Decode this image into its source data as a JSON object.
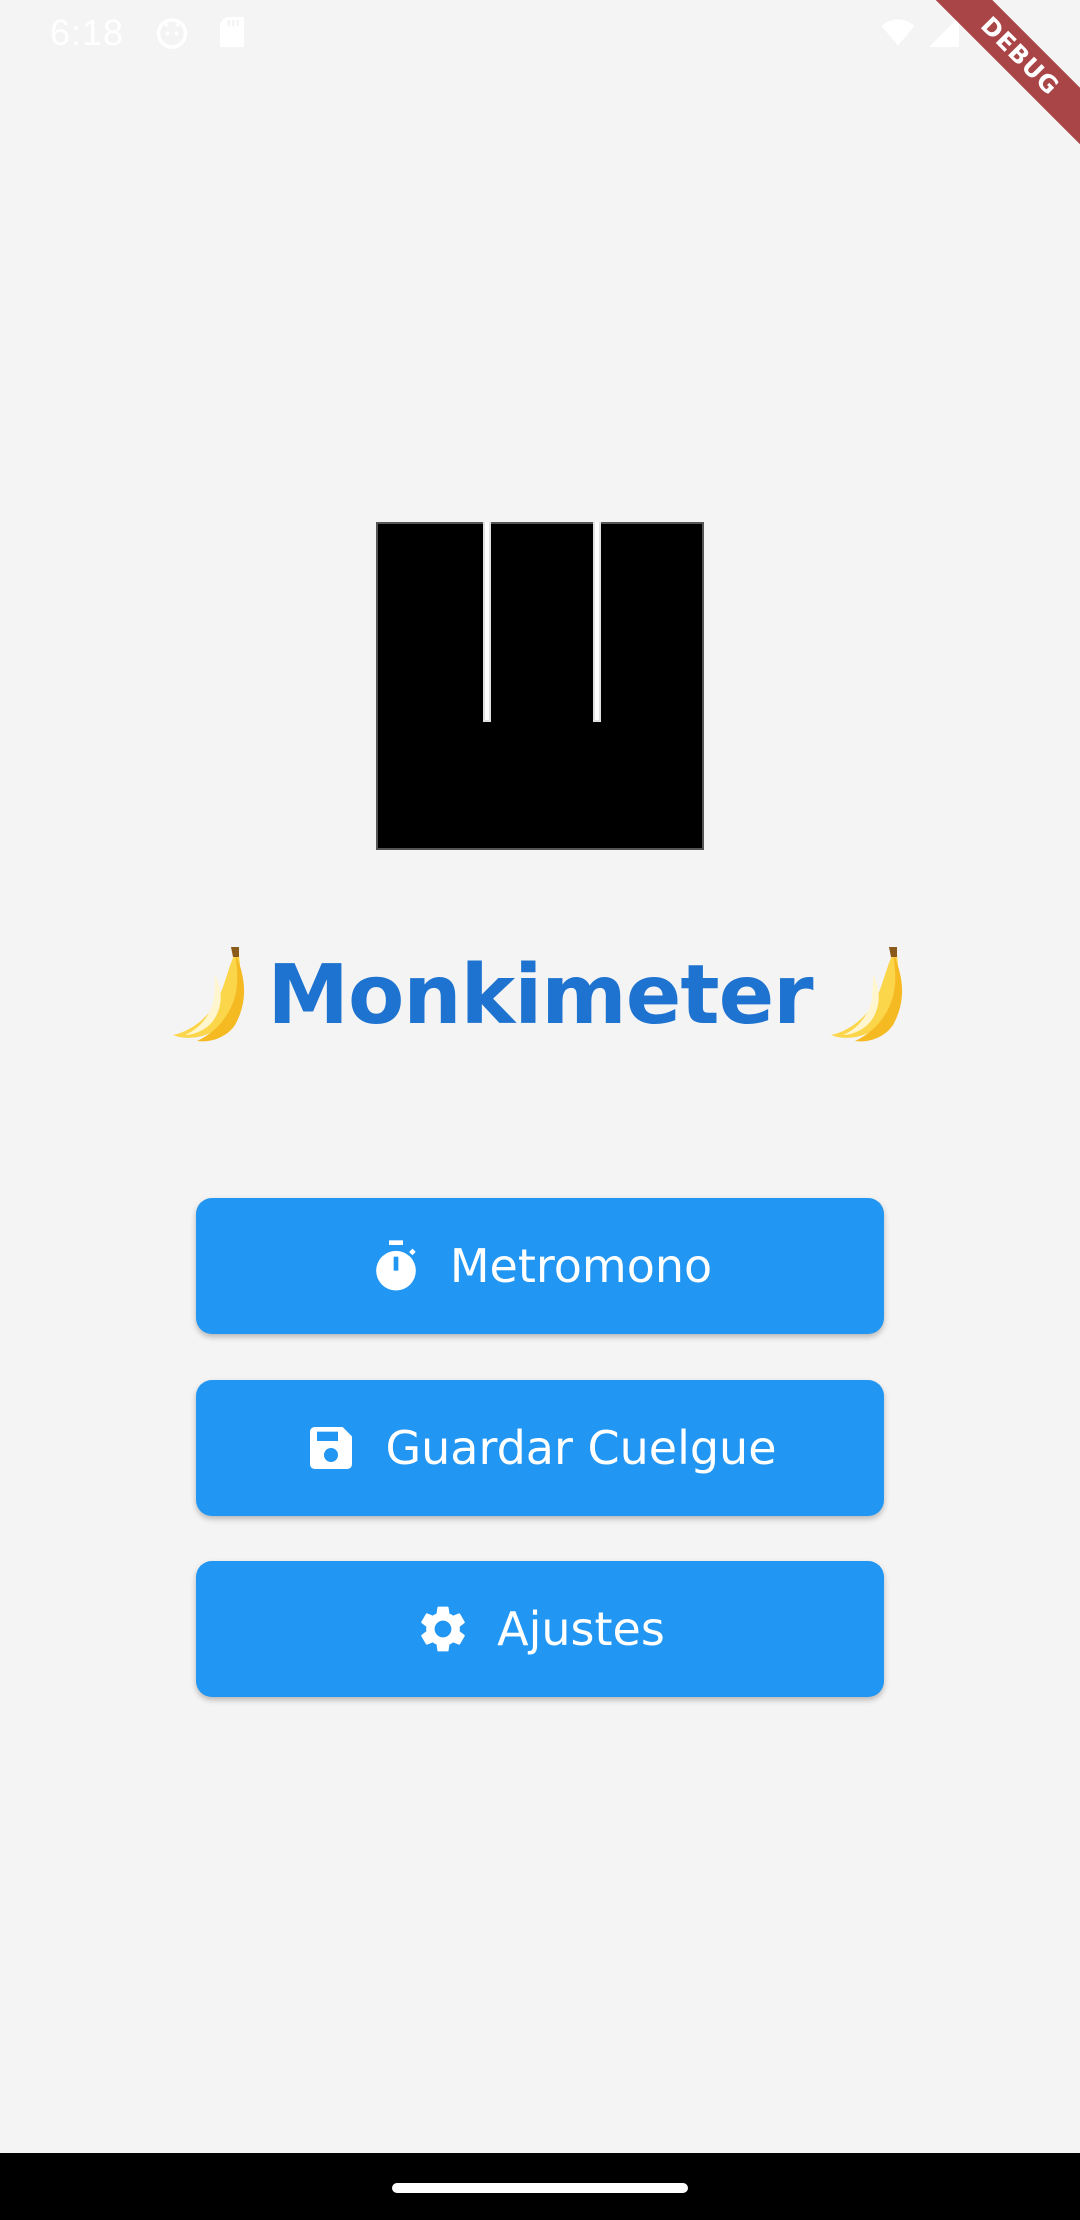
{
  "status_bar": {
    "time": "6:18",
    "left_icons": [
      "android-face-icon",
      "sd-card-icon"
    ],
    "right_icons": [
      "wifi-icon",
      "cell-signal-icon",
      "battery-icon"
    ]
  },
  "debug_banner": {
    "label": "DEBUG"
  },
  "app": {
    "title": "Monkimeter",
    "title_decoration": "banana-icon",
    "accent_color": "#2196f3",
    "title_color": "#1f73d0"
  },
  "buttons": [
    {
      "label": "Metromono",
      "icon": "stopwatch-icon"
    },
    {
      "label": "Guardar Cuelgue",
      "icon": "save-icon"
    },
    {
      "label": "Ajustes",
      "icon": "gear-icon"
    }
  ]
}
